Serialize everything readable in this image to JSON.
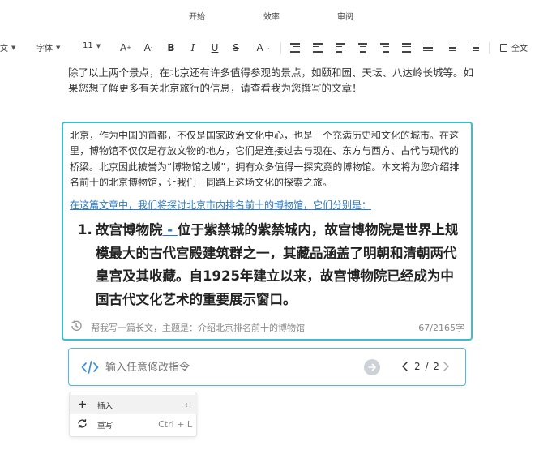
{
  "menu": {
    "tabs": [
      "开始",
      "效率",
      "审阅"
    ]
  },
  "toolbar": {
    "style_label": "正文",
    "font_label": "字体",
    "size_label": "11",
    "fulltext_label": "全文"
  },
  "document": {
    "top_paragraph": "除了以上两个景点，在北京还有许多值得参观的景点，如颐和园、天坛、八达岭长城等。如果您想了解更多有关北京旅行的信息，请查看我为您撰写的文章！"
  },
  "ai_card": {
    "intro": "北京，作为中国的首都，不仅是国家政治文化中心，也是一个充满历史和文化的城市。在这里，博物馆不仅仅是存放文物的地方，它们是连接过去与现在、东方与西方、古代与现代的桥梁。北京因此被誉为“博物馆之城”，拥有众多值得一探究竟的博物馆。本文将为您介绍排名前十的北京博物馆，让我们一同踏上这场文化的探索之旅。",
    "link_text": "在这篇文章中，我们将探讨北京市内排名前十的博物馆，它们分别是：",
    "list_number": "1.",
    "list_title": "故宫博物院",
    "list_dash": " - ",
    "list_body": "位于紫禁城的紫禁城内，故宫博物院是世界上规模最大的古代宫殿建筑群之一，其藏品涵盖了明朝和清朝两代皇宫及其收藏。自1925年建立以来，故宫博物院已经成为中国古代文化艺术的重要展示窗口。",
    "prompt_text": "帮我写一篇长文，主题是：介绍北京排名前十的博物馆",
    "word_count": "67/2165字"
  },
  "instruction": {
    "placeholder": "输入任意修改指令",
    "pager": "2 / 2"
  },
  "dropdown": {
    "items": [
      {
        "label": "插入",
        "shortcut": "↵"
      },
      {
        "label": "重写",
        "shortcut": "Ctrl + L"
      }
    ]
  },
  "colors": {
    "accent": "#38bdd1",
    "link": "#2b78c5"
  }
}
